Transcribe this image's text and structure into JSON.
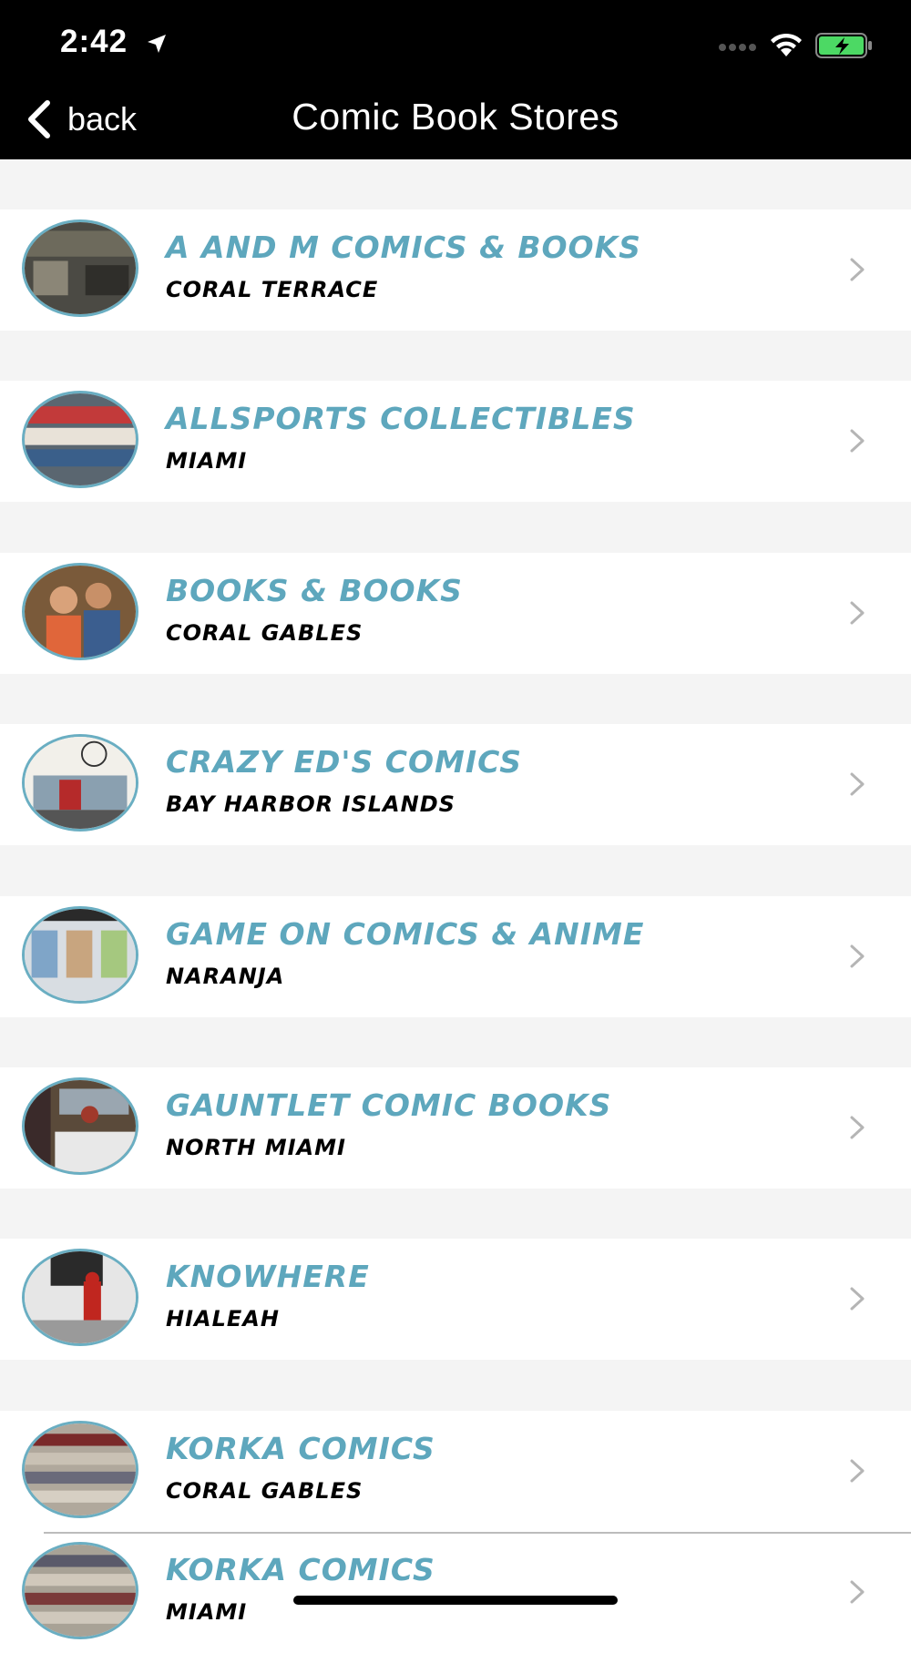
{
  "status_bar": {
    "time": "2:42"
  },
  "nav": {
    "back_label": "back",
    "title": "Comic Book Stores"
  },
  "stores": [
    {
      "name": "A and M Comics & Books",
      "city": "Coral Terrace"
    },
    {
      "name": "Allsports Collectibles",
      "city": "Miami"
    },
    {
      "name": "Books & Books",
      "city": "Coral Gables"
    },
    {
      "name": "Crazy Ed's Comics",
      "city": "Bay Harbor Islands"
    },
    {
      "name": "Game On Comics & Anime",
      "city": "Naranja"
    },
    {
      "name": "Gauntlet Comic Books",
      "city": "North Miami"
    },
    {
      "name": "Knowhere",
      "city": "Hialeah"
    },
    {
      "name": "Korka Comics",
      "city": "Coral Gables"
    },
    {
      "name": "Korka Comics",
      "city": "Miami"
    }
  ],
  "colors": {
    "accent": "#5ea7bd",
    "header_bg": "#000000",
    "list_bg": "#f4f4f4",
    "row_bg": "#ffffff",
    "battery_green": "#4cd964"
  },
  "icons": [
    "location-arrow-icon",
    "cell-signal-icon",
    "wifi-icon",
    "battery-icon",
    "back-chevron-icon",
    "chevron-right-icon"
  ]
}
